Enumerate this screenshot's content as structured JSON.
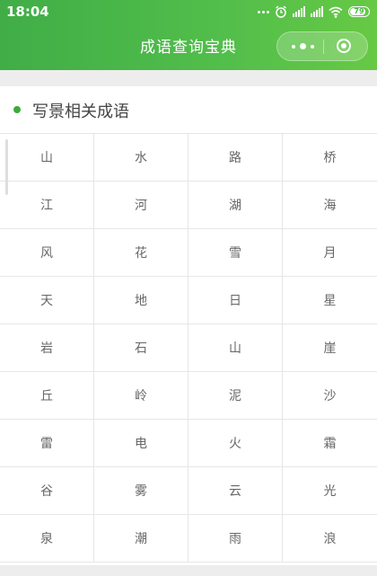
{
  "status_bar": {
    "time": "18:04",
    "battery": "79",
    "icons": [
      "more-dots-icon",
      "alarm-icon",
      "signal-icon",
      "signal-icon",
      "wifi-icon",
      "battery-icon"
    ]
  },
  "nav": {
    "title": "成语查询宝典",
    "capsule_icons": [
      "more-icon",
      "close-mini-program-icon"
    ]
  },
  "section": {
    "title": "写景相关成语",
    "accent_color": "#3daa3d",
    "items": [
      "山",
      "水",
      "路",
      "桥",
      "江",
      "河",
      "湖",
      "海",
      "风",
      "花",
      "雪",
      "月",
      "天",
      "地",
      "日",
      "星",
      "岩",
      "石",
      "山",
      "崖",
      "丘",
      "岭",
      "泥",
      "沙",
      "雷",
      "电",
      "火",
      "霜",
      "谷",
      "雾",
      "云",
      "光",
      "泉",
      "潮",
      "雨",
      "浪"
    ]
  }
}
